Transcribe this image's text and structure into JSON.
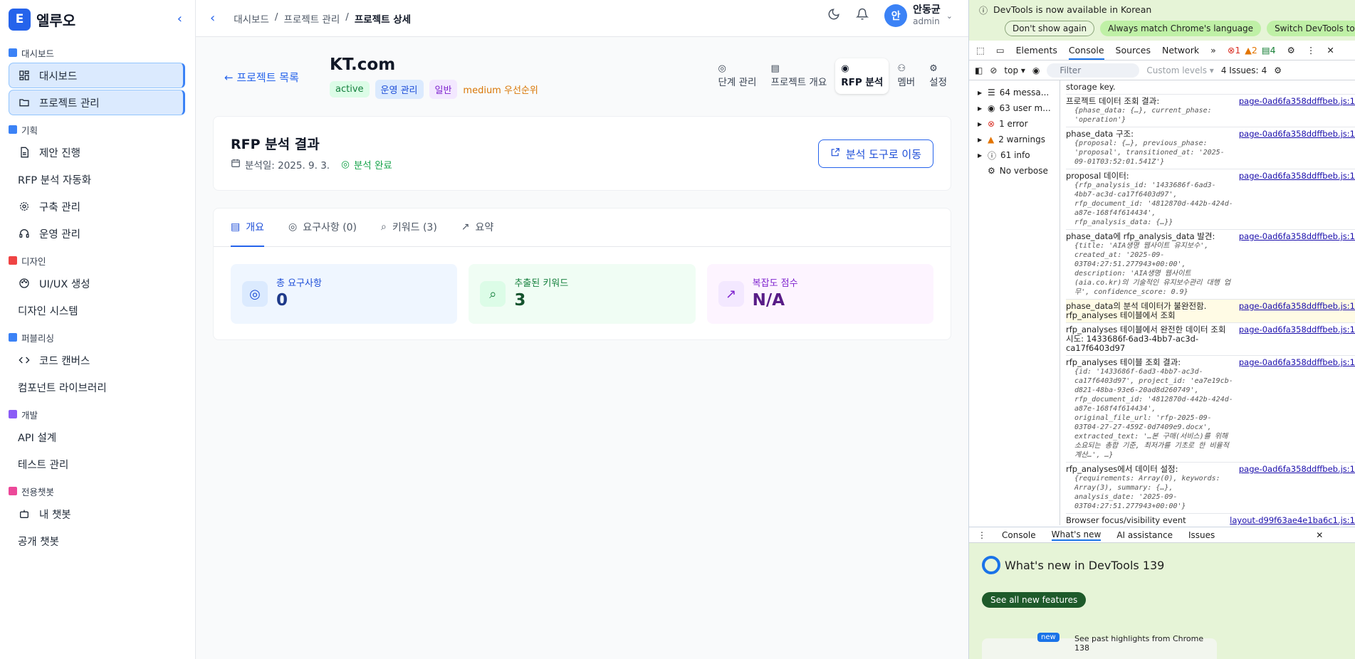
{
  "brand": {
    "letter": "E",
    "name": "엘루오"
  },
  "sidebar": {
    "sections": [
      {
        "title": "대시보드",
        "color": "#3b82f6",
        "items": [
          {
            "label": "대시보드",
            "icon": "dashboard-icon",
            "active": true
          },
          {
            "label": "프로젝트 관리",
            "icon": "folder-icon",
            "active": true
          }
        ]
      },
      {
        "title": "기획",
        "color": "#3b82f6",
        "items": [
          {
            "label": "제안 진행",
            "icon": "document-icon"
          },
          {
            "label": "RFP 분석 자동화",
            "icon": ""
          },
          {
            "label": "구축 관리",
            "icon": "gear-icon"
          },
          {
            "label": "운영 관리",
            "icon": "headset-icon"
          }
        ]
      },
      {
        "title": "디자인",
        "color": "#ef4444",
        "items": [
          {
            "label": "UI/UX 생성",
            "icon": "palette-icon"
          },
          {
            "label": "디자인 시스템",
            "icon": ""
          }
        ]
      },
      {
        "title": "퍼블리싱",
        "color": "#3b82f6",
        "items": [
          {
            "label": "코드 캔버스",
            "icon": "code-icon"
          },
          {
            "label": "컴포넌트 라이브러리",
            "icon": ""
          }
        ]
      },
      {
        "title": "개발",
        "color": "#8b5cf6",
        "items": [
          {
            "label": "API 설계",
            "icon": ""
          },
          {
            "label": "테스트 관리",
            "icon": ""
          }
        ]
      },
      {
        "title": "전용챗봇",
        "color": "#ec4899",
        "items": [
          {
            "label": "내 챗봇",
            "icon": "bot-icon"
          },
          {
            "label": "공개 챗봇",
            "icon": ""
          }
        ]
      }
    ]
  },
  "topbar": {
    "crumbs": [
      "대시보드",
      "/",
      "프로젝트 관리",
      "/",
      "프로젝트 상세"
    ],
    "user_initial": "안",
    "user_name": "안동균",
    "user_role": "admin"
  },
  "project": {
    "back_label": "← 프로젝트 목록",
    "title": "KT.com",
    "badges": [
      {
        "text": "active",
        "bg": "#dcfce7",
        "fg": "#15803d"
      },
      {
        "text": "운영 관리",
        "bg": "#dbeafe",
        "fg": "#1d4ed8"
      },
      {
        "text": "일반",
        "bg": "#f3e8ff",
        "fg": "#7e22ce"
      },
      {
        "text": "medium 우선순위",
        "bg": "transparent",
        "fg": "#d97706"
      }
    ],
    "tabs": [
      {
        "label": "단계 관리"
      },
      {
        "label": "프로젝트 개요"
      },
      {
        "label": "RFP 분석",
        "active": true
      },
      {
        "label": "멤버"
      },
      {
        "label": "설정"
      }
    ]
  },
  "rfp": {
    "title": "RFP 분석 결과",
    "date": "분석일: 2025. 9. 3.",
    "status": "분석 완료",
    "tool_button": "분석 도구로 이동"
  },
  "tabs": [
    {
      "label": "개요",
      "active": true
    },
    {
      "label": "요구사항 (0)"
    },
    {
      "label": "키워드 (3)"
    },
    {
      "label": "요약"
    }
  ],
  "stats": [
    {
      "label": "총 요구사항",
      "value": "0",
      "bg": "#eff6ff",
      "fg": "#1e3a8a",
      "lc": "#1d4ed8",
      "ibg": "#dbeafe"
    },
    {
      "label": "추출된 키워드",
      "value": "3",
      "bg": "#f0fdf4",
      "fg": "#14532d",
      "lc": "#15803d",
      "ibg": "#dcfce7"
    },
    {
      "label": "복잡도 점수",
      "value": "N/A",
      "bg": "#fdf4ff",
      "fg": "#581c87",
      "lc": "#7e22ce",
      "ibg": "#f3e8ff"
    }
  ],
  "devtools": {
    "info": "DevTools is now available in Korean",
    "info_buttons": [
      "Don't show again",
      "Always match Chrome's language",
      "Switch DevTools to Korean"
    ],
    "tabs": [
      "Elements",
      "Console",
      "Sources",
      "Network"
    ],
    "counts": {
      "errors": "1",
      "warnings": "2",
      "messages": "4"
    },
    "toolbar": {
      "context": "top ▾",
      "filter": "Filter",
      "levels": "Custom levels ▾",
      "issues": "4 Issues:",
      "issue_count": "4"
    },
    "side": [
      "64 messa...",
      "63 user m...",
      "1 error",
      "2 warnings",
      "61 info",
      "No verbose"
    ],
    "logs": [
      {
        "text": "storage key.",
        "src": "",
        "obj": ""
      },
      {
        "text": "프로젝트 데이터 조회 결과:",
        "src": "page-0ad6fa358ddffbeb.js:1",
        "obj": "{phase_data: {…}, current_phase: 'operation'}"
      },
      {
        "text": "phase_data 구조:",
        "src": "page-0ad6fa358ddffbeb.js:1",
        "obj": "{proposal: {…}, previous_phase: 'proposal', transitioned_at: '2025-09-01T03:52:01.541Z'}"
      },
      {
        "text": "proposal 데이터:",
        "src": "page-0ad6fa358ddffbeb.js:1",
        "obj": "{rfp_analysis_id: '1433686f-6ad3-4bb7-ac3d-ca17f6403d97', rfp_document_id: '4812870d-442b-424d-a87e-168f4f614434', rfp_analysis_data: {…}}"
      },
      {
        "text": "phase_data에 rfp_analysis_data 발견:",
        "src": "page-0ad6fa358ddffbeb.js:1",
        "obj": "{title: 'AIA생명 웹사이트 유지보수', created_at: '2025-09-03T04:27:51.277943+00:00', description: 'AIA생명 웹사이트(aia.co.kr)의 기술적인 유지보수관리 대행 업무', confidence_score: 0.9}"
      },
      {
        "text": "phase_data의 분석 데이터가 불완전함. rfp_analyses 테이블에서 조회",
        "src": "page-0ad6fa358ddffbeb.js:1",
        "obj": "",
        "warn": true
      },
      {
        "text": "rfp_analyses 테이블에서 완전한 데이터 조회 시도: 1433686f-6ad3-4bb7-ac3d-ca17f6403d97",
        "src": "page-0ad6fa358ddffbeb.js:1",
        "obj": ""
      },
      {
        "text": "rfp_analyses 테이블 조회 결과:",
        "src": "page-0ad6fa358ddffbeb.js:1",
        "obj": "{id: '1433686f-6ad3-4bb7-ac3d-ca17f6403d97', project_id: 'ea7e19cb-d821-48ba-93e6-20ad8d260749', rfp_document_id: '4812870d-442b-424d-a87e-168f4f614434', original_file_url: 'rfp-2025-09-03T04-27-27-459Z-0d7409e9.docx', extracted_text: '…본 구매(서비스)를 위해 소요되는 총합 기준, 최저가를 기초로 한 비율적 계산…', …}"
      },
      {
        "text": "rfp_analyses에서 데이터 설정:",
        "src": "page-0ad6fa358ddffbeb.js:1",
        "obj": "{requirements: Array(0), keywords: Array(3), summary: {…}, analysis_date: '2025-09-03T04:27:51.277943+00:00'}"
      },
      {
        "text": "Browser focus/visibility event detected, but preventing automatic data refresh",
        "src": "layout-d99f63ae4e1ba6c1.js:1",
        "obj": ""
      }
    ],
    "drawer_tabs": [
      "Console",
      "What's new",
      "AI assistance",
      "Issues"
    ],
    "whats_new": "What's new in DevTools 139",
    "see_all": "See all new features",
    "new_badge": "new",
    "past": "See past highlights from Chrome 138"
  }
}
